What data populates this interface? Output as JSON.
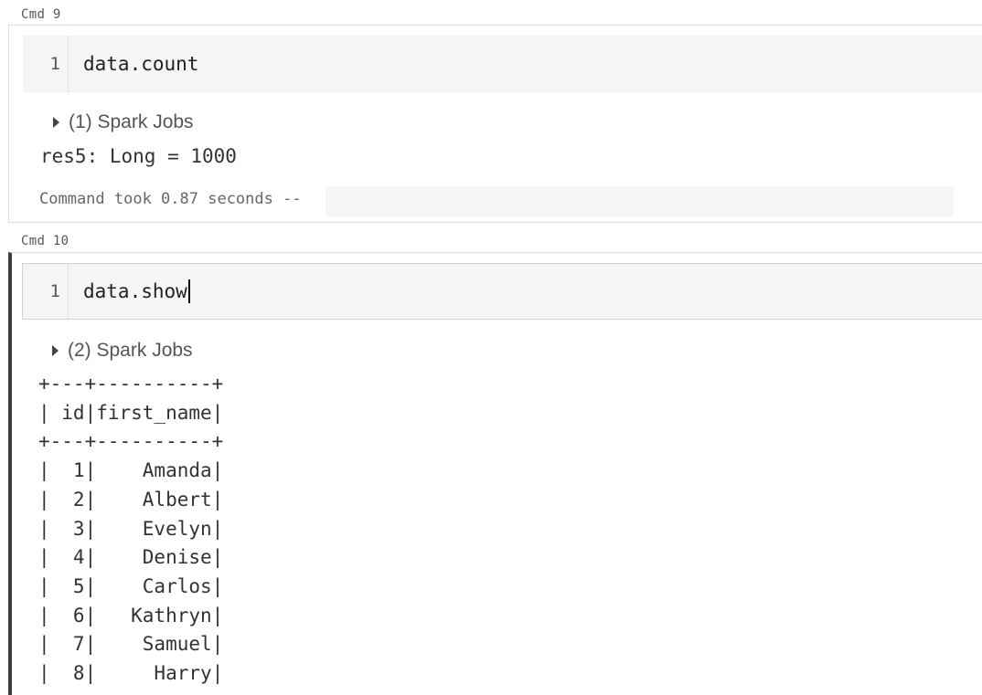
{
  "cells": [
    {
      "label": "Cmd 9",
      "line_number": "1",
      "code": "data.count",
      "spark_jobs": "(1) Spark Jobs",
      "result": "res5: Long = 1000",
      "footer": "Command took 0.87 seconds --"
    },
    {
      "label": "Cmd 10",
      "line_number": "1",
      "code": "data.show",
      "spark_jobs": "(2) Spark Jobs",
      "table": {
        "columns": [
          "id",
          "first_name"
        ],
        "rows": [
          [
            "1",
            "Amanda"
          ],
          [
            "2",
            "Albert"
          ],
          [
            "3",
            "Evelyn"
          ],
          [
            "4",
            "Denise"
          ],
          [
            "5",
            "Carlos"
          ],
          [
            "6",
            "Kathryn"
          ],
          [
            "7",
            "Samuel"
          ],
          [
            "8",
            "Harry"
          ]
        ]
      }
    }
  ],
  "colors": {
    "editor_bg": "#f5f5f5",
    "active_cell_border": "#3d3d3d",
    "cell_border": "#dcdcdc"
  },
  "icons": {
    "expand": "triangle-right-icon"
  }
}
